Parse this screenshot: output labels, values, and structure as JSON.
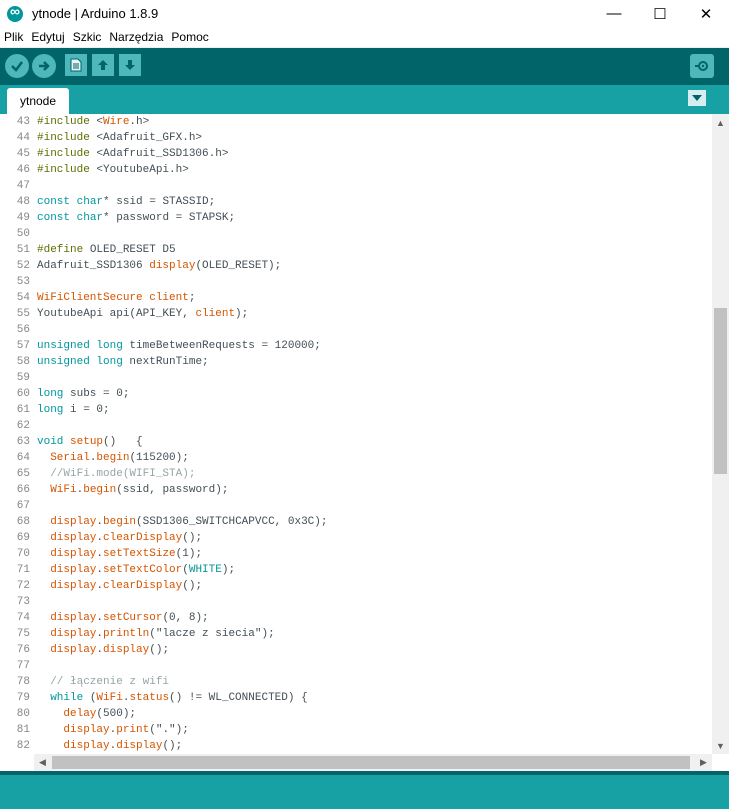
{
  "window": {
    "title": "ytnode | Arduino 1.8.9",
    "minimize": "—",
    "maximize": "☐",
    "close": "✕"
  },
  "menu": [
    "Plik",
    "Edytuj",
    "Szkic",
    "Narzędzia",
    "Pomoc"
  ],
  "toolbar": {
    "buttons": [
      "verify-icon",
      "upload-icon",
      "new-icon",
      "open-icon",
      "save-icon"
    ],
    "serial_monitor": "serial-monitor-icon"
  },
  "tabs": {
    "active": "ytnode"
  },
  "colors": {
    "toolbar_bg": "#006468",
    "tab_bg": "#17a1a5",
    "keyword": "#00979c",
    "function": "#d35400",
    "preprocessor": "#5e6d03",
    "comment": "#95a5a6",
    "text": "#434f54"
  },
  "code_lines": [
    {
      "n": "43",
      "t": [
        [
          "pp",
          "#include"
        ],
        [
          "",
          " <"
        ],
        [
          "fn",
          "Wire"
        ],
        [
          "",
          ".h>"
        ]
      ]
    },
    {
      "n": "44",
      "t": [
        [
          "pp",
          "#include"
        ],
        [
          "",
          " <Adafruit_GFX.h>"
        ]
      ]
    },
    {
      "n": "45",
      "t": [
        [
          "pp",
          "#include"
        ],
        [
          "",
          " <Adafruit_SSD1306.h>"
        ]
      ]
    },
    {
      "n": "46",
      "t": [
        [
          "pp",
          "#include"
        ],
        [
          "",
          " <YoutubeApi.h>"
        ]
      ]
    },
    {
      "n": "47",
      "t": []
    },
    {
      "n": "48",
      "t": [
        [
          "kw",
          "const"
        ],
        [
          "",
          " "
        ],
        [
          "kw",
          "char"
        ],
        [
          "",
          "* ssid = STASSID;"
        ]
      ]
    },
    {
      "n": "49",
      "t": [
        [
          "kw",
          "const"
        ],
        [
          "",
          " "
        ],
        [
          "kw",
          "char"
        ],
        [
          "",
          "* password = STAPSK;"
        ]
      ]
    },
    {
      "n": "50",
      "t": []
    },
    {
      "n": "51",
      "t": [
        [
          "pp",
          "#define"
        ],
        [
          "",
          " OLED_RESET D5"
        ]
      ]
    },
    {
      "n": "52",
      "t": [
        [
          "",
          "Adafruit_SSD1306 "
        ],
        [
          "fn",
          "display"
        ],
        [
          "",
          "(OLED_RESET);"
        ]
      ]
    },
    {
      "n": "53",
      "t": []
    },
    {
      "n": "54",
      "t": [
        [
          "fn",
          "WiFiClientSecure"
        ],
        [
          "",
          " "
        ],
        [
          "fn",
          "client"
        ],
        [
          "",
          ";"
        ]
      ]
    },
    {
      "n": "55",
      "t": [
        [
          "",
          "YoutubeApi api(API_KEY, "
        ],
        [
          "fn",
          "client"
        ],
        [
          "",
          ");"
        ]
      ]
    },
    {
      "n": "56",
      "t": []
    },
    {
      "n": "57",
      "t": [
        [
          "kw",
          "unsigned"
        ],
        [
          "",
          " "
        ],
        [
          "kw",
          "long"
        ],
        [
          "",
          " timeBetweenRequests = 120000;"
        ]
      ]
    },
    {
      "n": "58",
      "t": [
        [
          "kw",
          "unsigned"
        ],
        [
          "",
          " "
        ],
        [
          "kw",
          "long"
        ],
        [
          "",
          " nextRunTime;"
        ]
      ]
    },
    {
      "n": "59",
      "t": []
    },
    {
      "n": "60",
      "t": [
        [
          "kw",
          "long"
        ],
        [
          "",
          " subs = 0;"
        ]
      ]
    },
    {
      "n": "61",
      "t": [
        [
          "kw",
          "long"
        ],
        [
          "",
          " i = 0;"
        ]
      ]
    },
    {
      "n": "62",
      "t": []
    },
    {
      "n": "63",
      "t": [
        [
          "kw",
          "void"
        ],
        [
          "",
          " "
        ],
        [
          "fn",
          "setup"
        ],
        [
          "",
          "()   {"
        ]
      ]
    },
    {
      "n": "64",
      "t": [
        [
          "",
          "  "
        ],
        [
          "fn",
          "Serial"
        ],
        [
          "",
          "."
        ],
        [
          "fn",
          "begin"
        ],
        [
          "",
          "(115200);"
        ]
      ]
    },
    {
      "n": "65",
      "t": [
        [
          "cm",
          "  //WiFi.mode(WIFI_STA);"
        ]
      ]
    },
    {
      "n": "66",
      "t": [
        [
          "",
          "  "
        ],
        [
          "fn",
          "WiFi"
        ],
        [
          "",
          "."
        ],
        [
          "fn",
          "begin"
        ],
        [
          "",
          "(ssid, password);"
        ]
      ]
    },
    {
      "n": "67",
      "t": []
    },
    {
      "n": "68",
      "t": [
        [
          "",
          "  "
        ],
        [
          "fn",
          "display"
        ],
        [
          "",
          "."
        ],
        [
          "fn",
          "begin"
        ],
        [
          "",
          "(SSD1306_SWITCHCAPVCC, 0x3C);"
        ]
      ]
    },
    {
      "n": "69",
      "t": [
        [
          "",
          "  "
        ],
        [
          "fn",
          "display"
        ],
        [
          "",
          "."
        ],
        [
          "fn",
          "clearDisplay"
        ],
        [
          "",
          "();"
        ]
      ]
    },
    {
      "n": "70",
      "t": [
        [
          "",
          "  "
        ],
        [
          "fn",
          "display"
        ],
        [
          "",
          "."
        ],
        [
          "fn",
          "setTextSize"
        ],
        [
          "",
          "(1);"
        ]
      ]
    },
    {
      "n": "71",
      "t": [
        [
          "",
          "  "
        ],
        [
          "fn",
          "display"
        ],
        [
          "",
          "."
        ],
        [
          "fn",
          "setTextColor"
        ],
        [
          "",
          "("
        ],
        [
          "kw",
          "WHITE"
        ],
        [
          "",
          ");"
        ]
      ]
    },
    {
      "n": "72",
      "t": [
        [
          "",
          "  "
        ],
        [
          "fn",
          "display"
        ],
        [
          "",
          "."
        ],
        [
          "fn",
          "clearDisplay"
        ],
        [
          "",
          "();"
        ]
      ]
    },
    {
      "n": "73",
      "t": []
    },
    {
      "n": "74",
      "t": [
        [
          "",
          "  "
        ],
        [
          "fn",
          "display"
        ],
        [
          "",
          "."
        ],
        [
          "fn",
          "setCursor"
        ],
        [
          "",
          "(0, 8);"
        ]
      ]
    },
    {
      "n": "75",
      "t": [
        [
          "",
          "  "
        ],
        [
          "fn",
          "display"
        ],
        [
          "",
          "."
        ],
        [
          "fn",
          "println"
        ],
        [
          "",
          "(\"lacze z siecia\");"
        ]
      ]
    },
    {
      "n": "76",
      "t": [
        [
          "",
          "  "
        ],
        [
          "fn",
          "display"
        ],
        [
          "",
          "."
        ],
        [
          "fn",
          "display"
        ],
        [
          "",
          "();"
        ]
      ]
    },
    {
      "n": "77",
      "t": []
    },
    {
      "n": "78",
      "t": [
        [
          "cm",
          "  // łączenie z wifi"
        ]
      ]
    },
    {
      "n": "79",
      "t": [
        [
          "",
          "  "
        ],
        [
          "kw",
          "while"
        ],
        [
          "",
          " ("
        ],
        [
          "fn",
          "WiFi"
        ],
        [
          "",
          "."
        ],
        [
          "fn",
          "status"
        ],
        [
          "",
          "() != WL_CONNECTED) {"
        ]
      ]
    },
    {
      "n": "80",
      "t": [
        [
          "",
          "    "
        ],
        [
          "fn",
          "delay"
        ],
        [
          "",
          "(500);"
        ]
      ]
    },
    {
      "n": "81",
      "t": [
        [
          "",
          "    "
        ],
        [
          "fn",
          "display"
        ],
        [
          "",
          "."
        ],
        [
          "fn",
          "print"
        ],
        [
          "",
          "(\".\");"
        ]
      ]
    },
    {
      "n": "82",
      "t": [
        [
          "",
          "    "
        ],
        [
          "fn",
          "display"
        ],
        [
          "",
          "."
        ],
        [
          "fn",
          "display"
        ],
        [
          "",
          "();"
        ]
      ]
    }
  ]
}
